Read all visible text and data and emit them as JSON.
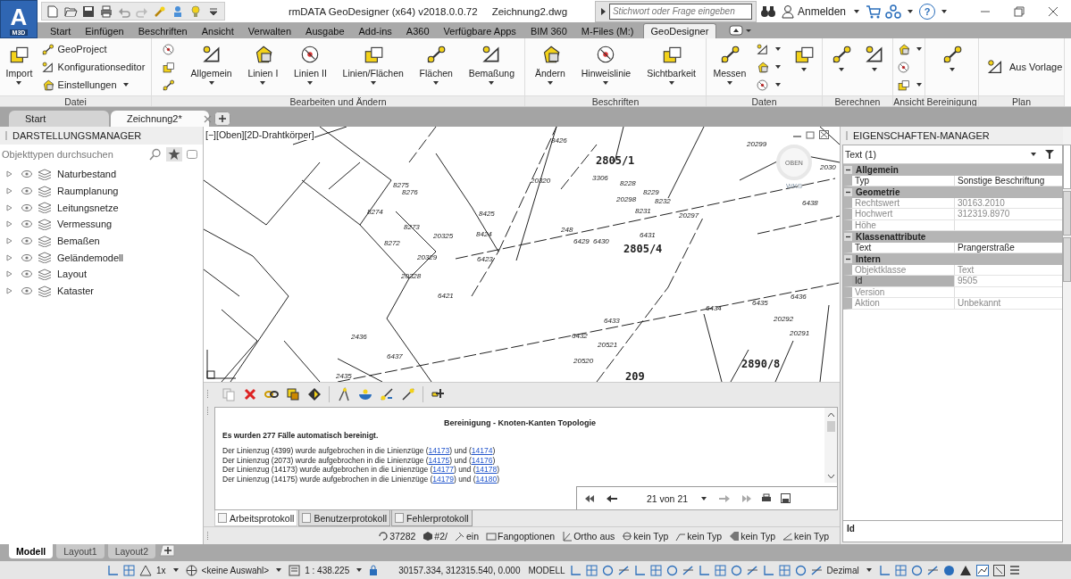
{
  "app_logo": {
    "letter": "A",
    "badge": "M3D"
  },
  "window": {
    "title": "rmDATA GeoDesigner (x64) v2018.0.0.72",
    "document": "Zeichnung2.dwg"
  },
  "search": {
    "placeholder": "Stichwort oder Frage eingeben"
  },
  "account": {
    "label": "Anmelden"
  },
  "help": {
    "label": "?"
  },
  "menu_tabs": [
    {
      "label": "Start",
      "selected": false
    },
    {
      "label": "Einfügen",
      "selected": false
    },
    {
      "label": "Beschriften",
      "selected": false
    },
    {
      "label": "Ansicht",
      "selected": false
    },
    {
      "label": "Verwalten",
      "selected": false
    },
    {
      "label": "Ausgabe",
      "selected": false
    },
    {
      "label": "Add-ins",
      "selected": false
    },
    {
      "label": "A360",
      "selected": false
    },
    {
      "label": "Verfügbare Apps",
      "selected": false
    },
    {
      "label": "BIM 360",
      "selected": false
    },
    {
      "label": "M-Files (M:)",
      "selected": false
    },
    {
      "label": "GeoDesigner",
      "selected": true
    }
  ],
  "ribbon": {
    "panels": [
      {
        "title": "Datei",
        "groups": [
          {
            "kind": "large",
            "label": "Import",
            "caret": true
          },
          {
            "kind": "stack",
            "items": [
              {
                "label": "GeoProject",
                "caret": false
              },
              {
                "label": "Konfigurationseditor",
                "caret": false
              },
              {
                "label": "Einstellungen",
                "caret": true
              }
            ]
          }
        ]
      },
      {
        "title": "Bearbeiten und Ändern",
        "groups": [
          {
            "kind": "stack",
            "items": [
              {
                "caret": false
              },
              {
                "caret": false
              },
              {
                "caret": false
              }
            ]
          },
          {
            "kind": "large",
            "label": "Allgemein",
            "caret": true
          },
          {
            "kind": "large",
            "label": "Linien I",
            "caret": true
          },
          {
            "kind": "large",
            "label": "Linien II",
            "caret": true
          },
          {
            "kind": "large",
            "label": "Linien/Flächen",
            "caret": true
          },
          {
            "kind": "large",
            "label": "Flächen",
            "caret": true
          },
          {
            "kind": "large",
            "label": "Bemaßung",
            "caret": true
          }
        ]
      },
      {
        "title": "Beschriften",
        "groups": [
          {
            "kind": "large",
            "label": "Ändern",
            "caret": true
          },
          {
            "kind": "large",
            "label": "Hinweislinie",
            "caret": true
          },
          {
            "kind": "large",
            "label": "Sichtbarkeit",
            "caret": true
          }
        ]
      },
      {
        "title": "Daten",
        "groups": [
          {
            "kind": "large",
            "label": "Messen",
            "caret": true
          },
          {
            "kind": "stack",
            "items": [
              {
                "caret": true
              },
              {
                "caret": true
              },
              {
                "caret": true
              }
            ]
          },
          {
            "kind": "large",
            "caret": true
          }
        ]
      },
      {
        "title": "Berechnen",
        "groups": [
          {
            "kind": "large",
            "caret": true
          },
          {
            "kind": "large",
            "caret": true
          }
        ]
      },
      {
        "title": "Ansicht",
        "groups": [
          {
            "kind": "stack",
            "items": [
              {
                "caret": true
              },
              {
                "caret": false
              },
              {
                "caret": true
              }
            ]
          }
        ]
      },
      {
        "title": "Bereinigung",
        "groups": [
          {
            "kind": "large",
            "caret": true
          }
        ]
      },
      {
        "title": "Plan",
        "groups": [
          {
            "kind": "wide",
            "label": "Aus Vorlage"
          }
        ]
      }
    ]
  },
  "doc_tabs": [
    {
      "label": "Start",
      "selected": false
    },
    {
      "label": "Zeichnung2*",
      "selected": true
    }
  ],
  "display_manager": {
    "title": "DARSTELLUNGSMANAGER",
    "search_placeholder": "Objekttypen durchsuchen",
    "items": [
      {
        "label": "Naturbestand",
        "expanded": false,
        "visible": true
      },
      {
        "label": "Raumplanung",
        "expanded": false,
        "visible": true
      },
      {
        "label": "Leitungsnetze",
        "expanded": false,
        "visible": true
      },
      {
        "label": "Vermessung",
        "expanded": false,
        "visible": true
      },
      {
        "label": "Bemaßen",
        "expanded": false,
        "visible": true
      },
      {
        "label": "Geländemodell",
        "expanded": false,
        "visible": true
      },
      {
        "label": "Layout",
        "expanded": false,
        "visible": true
      },
      {
        "label": "Kataster",
        "expanded": false,
        "visible": true
      }
    ]
  },
  "drawing": {
    "viewport_label": "[−][Oben][2D-Drahtkörper]",
    "viewcube": {
      "face": "OBEN",
      "ucs": "WKS"
    },
    "labels": [
      {
        "text": "8426",
        "kind": "point"
      },
      {
        "text": "2805/1",
        "kind": "parcel"
      },
      {
        "text": "20299",
        "kind": "point"
      },
      {
        "text": "20320",
        "kind": "point"
      },
      {
        "text": "3306",
        "kind": "point"
      },
      {
        "text": "8228",
        "kind": "point"
      },
      {
        "text": "8229",
        "kind": "point"
      },
      {
        "text": "8232",
        "kind": "point"
      },
      {
        "text": "20298",
        "kind": "point"
      },
      {
        "text": "8231",
        "kind": "point"
      },
      {
        "text": "20297",
        "kind": "point"
      },
      {
        "text": "8275",
        "kind": "point"
      },
      {
        "text": "8276",
        "kind": "point"
      },
      {
        "text": "8274",
        "kind": "point"
      },
      {
        "text": "8273",
        "kind": "point"
      },
      {
        "text": "8425",
        "kind": "point"
      },
      {
        "text": "8424",
        "kind": "point"
      },
      {
        "text": "20325",
        "kind": "point"
      },
      {
        "text": "8272",
        "kind": "point"
      },
      {
        "text": "6423",
        "kind": "point"
      },
      {
        "text": "20329",
        "kind": "point"
      },
      {
        "text": "20328",
        "kind": "point"
      },
      {
        "text": "6421",
        "kind": "point"
      },
      {
        "text": "248",
        "kind": "point"
      },
      {
        "text": "6429",
        "kind": "point"
      },
      {
        "text": "6430",
        "kind": "point"
      },
      {
        "text": "6431",
        "kind": "point"
      },
      {
        "text": "2805/4",
        "kind": "parcel"
      },
      {
        "text": "6438",
        "kind": "point"
      },
      {
        "text": "2030",
        "kind": "point"
      },
      {
        "text": "6435",
        "kind": "point"
      },
      {
        "text": "6436",
        "kind": "point"
      },
      {
        "text": "6434",
        "kind": "point"
      },
      {
        "text": "20292",
        "kind": "point"
      },
      {
        "text": "6433",
        "kind": "point"
      },
      {
        "text": "6432",
        "kind": "point"
      },
      {
        "text": "20521",
        "kind": "point"
      },
      {
        "text": "20291",
        "kind": "point"
      },
      {
        "text": "20520",
        "kind": "point"
      },
      {
        "text": "2890/8",
        "kind": "parcel"
      },
      {
        "text": "209",
        "kind": "parcel"
      },
      {
        "text": "2436",
        "kind": "point"
      },
      {
        "text": "6437",
        "kind": "point"
      },
      {
        "text": "2435",
        "kind": "point"
      }
    ]
  },
  "log": {
    "title": "Bereinigung - Knoten-Kanten Topologie",
    "summary": "Es wurden 277 Fälle automatisch bereinigt.",
    "lines": [
      {
        "segments": [
          {
            "kind": "text",
            "text": "Der Linienzug (4399) wurde aufgebrochen in die Linienzüge ("
          },
          {
            "kind": "link",
            "text": "14173"
          },
          {
            "kind": "text",
            "text": ") und ("
          },
          {
            "kind": "link",
            "text": "14174"
          },
          {
            "kind": "text",
            "text": ")"
          }
        ]
      },
      {
        "segments": [
          {
            "kind": "text",
            "text": "Der Linienzug (2073) wurde aufgebrochen in die Linienzüge ("
          },
          {
            "kind": "link",
            "text": "14175"
          },
          {
            "kind": "text",
            "text": ") und ("
          },
          {
            "kind": "link",
            "text": "14176"
          },
          {
            "kind": "text",
            "text": ")"
          }
        ]
      },
      {
        "segments": [
          {
            "kind": "text",
            "text": "Der Linienzug (14173) wurde aufgebrochen in die Linienzüge ("
          },
          {
            "kind": "link",
            "text": "14177"
          },
          {
            "kind": "text",
            "text": ") und ("
          },
          {
            "kind": "link",
            "text": "14178"
          },
          {
            "kind": "text",
            "text": ")"
          }
        ]
      },
      {
        "segments": [
          {
            "kind": "text",
            "text": "Der Linienzug (14175) wurde aufgebrochen in die Linienzüge ("
          },
          {
            "kind": "link",
            "text": "14179"
          },
          {
            "kind": "text",
            "text": ") und ("
          },
          {
            "kind": "link",
            "text": "14180"
          },
          {
            "kind": "text",
            "text": ")"
          }
        ]
      }
    ],
    "pager": "21 von 21",
    "tabs": [
      {
        "label": "Arbeitsprotokoll",
        "selected": true
      },
      {
        "label": "Benutzerprotokoll",
        "selected": false
      },
      {
        "label": "Fehlerprotokoll",
        "selected": false
      }
    ]
  },
  "command_status": [
    {
      "text": "37282"
    },
    {
      "text": "#2/"
    },
    {
      "text": "ein"
    },
    {
      "text": "Fangoptionen"
    },
    {
      "text": "Ortho aus"
    },
    {
      "text": "kein Typ"
    },
    {
      "text": "kein Typ"
    },
    {
      "text": "kein Typ"
    },
    {
      "text": "kein Typ"
    }
  ],
  "properties": {
    "title": "EIGENSCHAFTEN-MANAGER",
    "selection": "Text (1)",
    "groups": [
      {
        "title": "Allgemein",
        "expanded": true,
        "rows": [
          {
            "name": "Typ",
            "value": "Sonstige Beschriftung",
            "disabled": false,
            "selected": false
          }
        ]
      },
      {
        "title": "Geometrie",
        "expanded": true,
        "rows": [
          {
            "name": "Rechtswert",
            "value": "30163.2010",
            "disabled": true,
            "selected": false
          },
          {
            "name": "Hochwert",
            "value": "312319.8970",
            "disabled": true,
            "selected": false
          },
          {
            "name": "Höhe",
            "disabled": true,
            "selected": false
          }
        ]
      },
      {
        "title": "Klassenattribute",
        "expanded": true,
        "rows": [
          {
            "name": "Text",
            "value": "Prangerstraße",
            "disabled": false,
            "selected": false
          }
        ]
      },
      {
        "title": "Intern",
        "expanded": true,
        "rows": [
          {
            "name": "Objektklasse",
            "value": "Text",
            "disabled": true,
            "selected": false
          },
          {
            "name": "Id",
            "value": "9505",
            "disabled": true,
            "selected": true
          },
          {
            "name": "Version",
            "disabled": true,
            "selected": false
          },
          {
            "name": "Aktion",
            "value": "Unbekannt",
            "disabled": true,
            "selected": false
          }
        ]
      }
    ],
    "description": "Id"
  },
  "side_tabs": [
    {
      "selected": true
    },
    {
      "selected": false
    },
    {
      "selected": false
    }
  ],
  "layout_tabs": [
    {
      "label": "Modell",
      "selected": true
    },
    {
      "label": "Layout1",
      "selected": false
    },
    {
      "label": "Layout2",
      "selected": false
    }
  ],
  "status_bar": {
    "scale_factor": "1x",
    "selection": "<keine Auswahl>",
    "scale": "1 : 438.225",
    "coordinates": "30157.334, 312315.540, 0.000",
    "space": "MODELL",
    "units": "Dezimal"
  }
}
